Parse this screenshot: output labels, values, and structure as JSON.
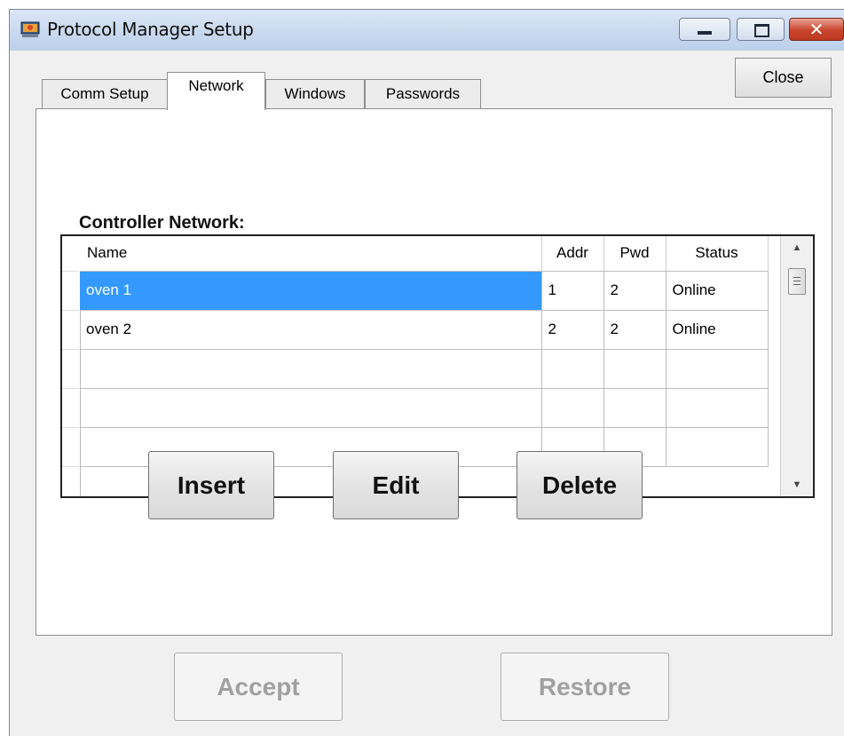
{
  "window": {
    "title": "Protocol Manager Setup"
  },
  "toolbar": {
    "close_label": "Close"
  },
  "tabs": [
    {
      "label": "Comm Setup",
      "selected": false
    },
    {
      "label": "Network",
      "selected": true
    },
    {
      "label": "Windows",
      "selected": false
    },
    {
      "label": "Passwords",
      "selected": false
    }
  ],
  "network": {
    "section_label": "Controller Network:",
    "columns": [
      "Name",
      "Addr",
      "Pwd",
      "Status"
    ],
    "rows": [
      {
        "name": "oven 1",
        "addr": "1",
        "pwd": "2",
        "status": "Online",
        "selected": true
      },
      {
        "name": "oven 2",
        "addr": "2",
        "pwd": "2",
        "status": "Online",
        "selected": false
      },
      {
        "name": "",
        "addr": "",
        "pwd": "",
        "status": ""
      },
      {
        "name": "",
        "addr": "",
        "pwd": "",
        "status": ""
      },
      {
        "name": "",
        "addr": "",
        "pwd": "",
        "status": ""
      }
    ],
    "buttons": {
      "insert": "Insert",
      "edit": "Edit",
      "delete": "Delete"
    }
  },
  "footer": {
    "accept": "Accept",
    "restore": "Restore",
    "accept_enabled": false,
    "restore_enabled": false
  },
  "colors": {
    "selection": "#3399ff",
    "titlebar": "#c9d9ee",
    "close_button": "#c9442c"
  }
}
